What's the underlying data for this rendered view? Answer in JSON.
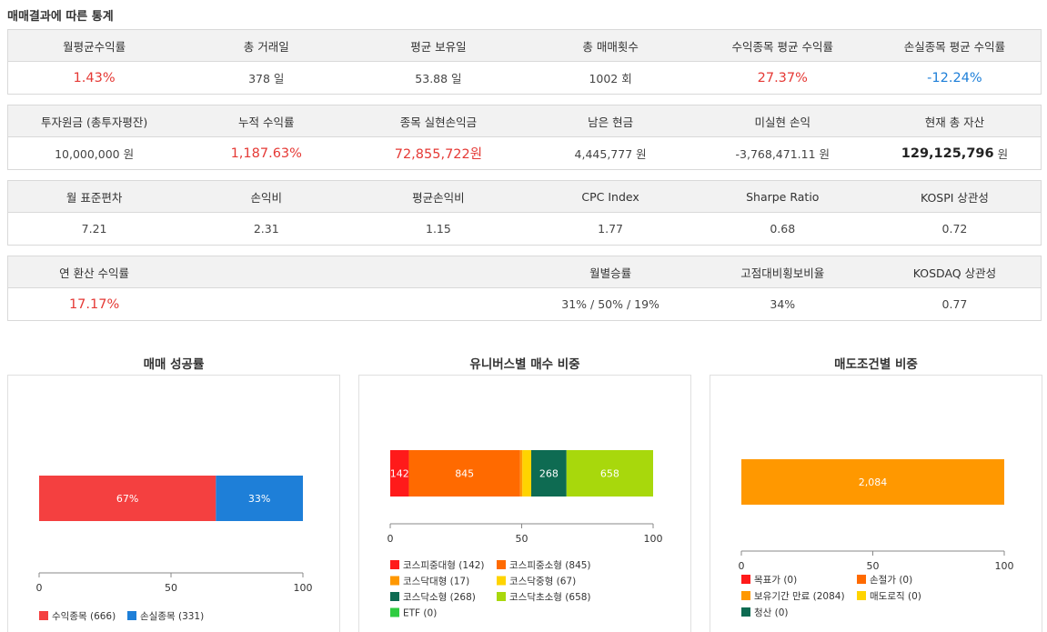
{
  "page_title": "매매결과에 따른 통계",
  "tables": [
    {
      "headers": [
        "월평균수익률",
        "총 거래일",
        "평균 보유일",
        "총 매매횟수",
        "수익종목 평균 수익률",
        "손실종목 평균 수익률"
      ],
      "values": [
        "1.43%",
        "378 일",
        "53.88 일",
        "1002 회",
        "27.37%",
        "-12.24%"
      ]
    },
    {
      "headers": [
        "투자원금 (총투자평잔)",
        "누적 수익률",
        "종목 실현손익금",
        "남은 현금",
        "미실현 손익",
        "현재 총 자산"
      ],
      "values": [
        "10,000,000 원",
        "1,187.63%",
        "72,855,722원",
        "4,445,777 원",
        "-3,768,471.11 원",
        "129,125,796"
      ],
      "unit_last": "원"
    },
    {
      "headers": [
        "월 표준편차",
        "손익비",
        "평균손익비",
        "CPC Index",
        "Sharpe Ratio",
        "KOSPI 상관성"
      ],
      "values": [
        "7.21",
        "2.31",
        "1.15",
        "1.77",
        "0.68",
        "0.72"
      ]
    },
    {
      "headers": [
        "연 환산 수익률",
        "",
        "",
        "월별승률",
        "고점대비횡보비율",
        "KOSDAQ 상관성"
      ],
      "values": [
        "17.17%",
        "",
        "",
        "31% / 50% / 19%",
        "34%",
        "0.77"
      ]
    }
  ],
  "panels": {
    "p1": {
      "title": "매매 성공률"
    },
    "p2": {
      "title": "유니버스별 매수 비중"
    },
    "p3": {
      "title": "매도조건별 비중"
    }
  },
  "colors": {
    "red": "#e53935",
    "blue": "#1e7fd8",
    "orange": "#ff6a00",
    "amber": "#ff9800",
    "yellow": "#ffd400",
    "darkgreen": "#0e6b52",
    "lime": "#a8d80c",
    "green": "#2ecc40"
  },
  "chart_data": [
    {
      "type": "bar",
      "title": "매매 성공률",
      "orientation": "horizontal-stacked",
      "xlim": [
        0,
        100
      ],
      "x_ticks": [
        "0",
        "50",
        "100"
      ],
      "series": [
        {
          "name": "수익종목 (666)",
          "value": 67,
          "label": "67%",
          "color": "#f44040"
        },
        {
          "name": "손실종목 (331)",
          "value": 33,
          "label": "33%",
          "color": "#1e7fd8"
        }
      ]
    },
    {
      "type": "bar",
      "title": "유니버스별 매수 비중",
      "orientation": "horizontal-stacked",
      "xlim": [
        0,
        100
      ],
      "x_ticks": [
        "0",
        "50",
        "100"
      ],
      "series": [
        {
          "name": "코스피중대형 (142)",
          "count": 142,
          "label": "142",
          "color": "#ff1a1a"
        },
        {
          "name": "코스피중소형 (845)",
          "count": 845,
          "label": "845",
          "color": "#ff6a00"
        },
        {
          "name": "코스닥대형 (17)",
          "count": 17,
          "label": "",
          "color": "#ff9800"
        },
        {
          "name": "코스닥중형 (67)",
          "count": 67,
          "label": "",
          "color": "#ffd400"
        },
        {
          "name": "코스닥소형 (268)",
          "count": 268,
          "label": "268",
          "color": "#0e6b52"
        },
        {
          "name": "코스닥초소형 (658)",
          "count": 658,
          "label": "658",
          "color": "#a8d80c"
        },
        {
          "name": "ETF (0)",
          "count": 0,
          "label": "",
          "color": "#2ecc40"
        }
      ]
    },
    {
      "type": "bar",
      "title": "매도조건별 비중",
      "orientation": "horizontal-stacked",
      "xlim": [
        0,
        100
      ],
      "x_ticks": [
        "0",
        "50",
        "100"
      ],
      "series": [
        {
          "name": "목표가 (0)",
          "count": 0,
          "label": "",
          "color": "#ff1a1a"
        },
        {
          "name": "손절가 (0)",
          "count": 0,
          "label": "",
          "color": "#ff6a00"
        },
        {
          "name": "보유기간 만료 (2084)",
          "count": 2084,
          "label": "2,084",
          "color": "#ff9800"
        },
        {
          "name": "매도로직 (0)",
          "count": 0,
          "label": "",
          "color": "#ffd400"
        },
        {
          "name": "청산 (0)",
          "count": 0,
          "label": "",
          "color": "#0e6b52"
        }
      ]
    }
  ]
}
